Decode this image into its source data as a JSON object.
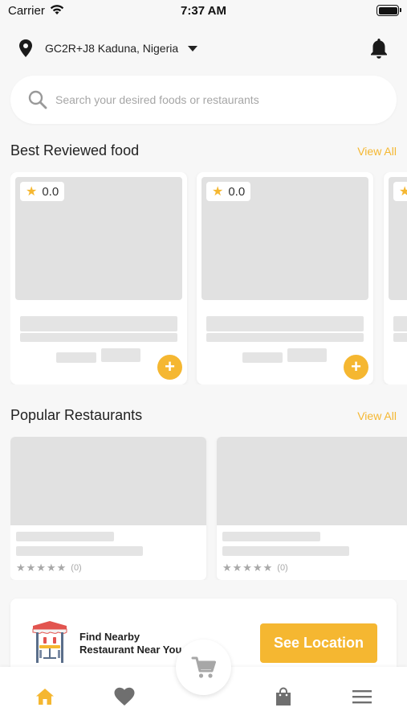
{
  "status_bar": {
    "carrier": "Carrier",
    "time": "7:37 AM"
  },
  "header": {
    "location": "GC2R+J8 Kaduna, Nigeria",
    "location_icon": "map-pin-icon",
    "notification_icon": "bell-icon"
  },
  "search": {
    "placeholder": "Search your desired foods or restaurants",
    "icon": "search-icon"
  },
  "best_reviewed": {
    "title": "Best Reviewed food",
    "view_all": "View All",
    "cards": [
      {
        "rating": "0.0"
      },
      {
        "rating": "0.0"
      },
      {
        "rating": ""
      }
    ]
  },
  "popular_restaurants": {
    "title": "Popular Restaurants",
    "view_all": "View All",
    "cards": [
      {
        "stars": "★★★★★",
        "review_count": "(0)"
      },
      {
        "stars": "★★★★★",
        "review_count": "(0)"
      }
    ]
  },
  "nearby": {
    "text_line1": "Find Nearby",
    "text_line2": "Restaurant Near You",
    "button": "See Location",
    "icon": "restaurant-table-icon"
  },
  "bottom_nav": {
    "items": [
      "home-icon",
      "heart-icon",
      "cart-icon",
      "bag-icon",
      "menu-icon"
    ],
    "active": "home-icon"
  },
  "colors": {
    "accent": "#f5b731",
    "placeholder": "#e1e1e1",
    "background": "#f7f7f7",
    "inactive_icon": "#6f6f6f"
  }
}
